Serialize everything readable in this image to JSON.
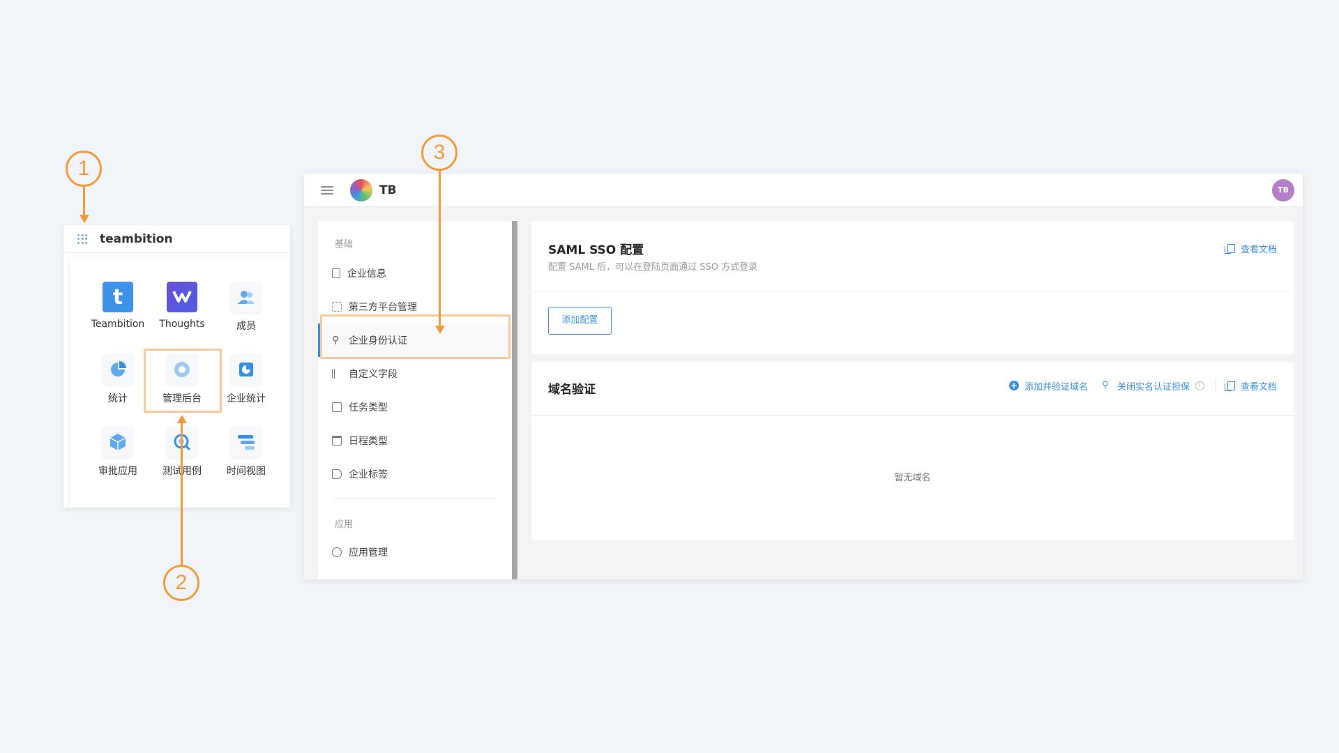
{
  "annotations": {
    "step1": "1",
    "step2": "2",
    "step3": "3"
  },
  "app_launcher": {
    "title": "teambition",
    "apps": [
      {
        "label": "Teambition",
        "icon": "teambition-logo-icon"
      },
      {
        "label": "Thoughts",
        "icon": "thoughts-logo-icon"
      },
      {
        "label": "成员",
        "icon": "members-icon"
      },
      {
        "label": "统计",
        "icon": "pie-chart-icon"
      },
      {
        "label": "管理后台",
        "icon": "admin-gear-icon"
      },
      {
        "label": "企业统计",
        "icon": "enterprise-stats-icon"
      },
      {
        "label": "审批应用",
        "icon": "cube-icon"
      },
      {
        "label": "测试用例",
        "icon": "test-case-icon"
      },
      {
        "label": "时间视图",
        "icon": "gantt-icon"
      }
    ]
  },
  "topbar": {
    "org_name": "TB",
    "user_initials": "TB"
  },
  "sidebar": {
    "section_basic": "基础",
    "items": [
      {
        "label": "企业信息",
        "icon": "building-icon"
      },
      {
        "label": "第三方平台管理",
        "icon": "grid-apps-icon"
      },
      {
        "label": "企业身份认证",
        "icon": "key-icon",
        "active": true
      },
      {
        "label": "自定义字段",
        "icon": "fields-icon"
      },
      {
        "label": "任务类型",
        "icon": "checkbox-icon"
      },
      {
        "label": "日程类型",
        "icon": "calendar-icon"
      },
      {
        "label": "企业标签",
        "icon": "tag-icon"
      }
    ],
    "section_apps": "应用",
    "app_items": [
      {
        "label": "应用管理",
        "icon": "hexagon-icon"
      }
    ]
  },
  "saml": {
    "title": "SAML SSO 配置",
    "subtitle": "配置 SAML 后，可以在登陆页面通过 SSO 方式登录",
    "doc_link": "查看文档",
    "add_button": "添加配置"
  },
  "domain": {
    "title": "域名验证",
    "add_verify": "添加并验证域名",
    "close_guarantee": "关闭实名认证担保",
    "doc_link": "查看文档",
    "empty": "暂无域名"
  },
  "colors": {
    "accent": "#3b8ee6",
    "annotation": "#f09a3e",
    "highlight": "#f8c999"
  }
}
